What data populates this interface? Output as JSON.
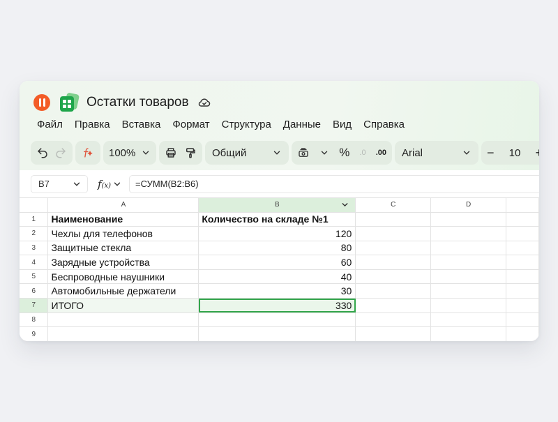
{
  "app": {
    "title": "Остатки товаров"
  },
  "menu": [
    "Файл",
    "Правка",
    "Вставка",
    "Формат",
    "Структура",
    "Данные",
    "Вид",
    "Справка"
  ],
  "toolbar": {
    "zoom": "100%",
    "number_format": "Общий",
    "percent": "%",
    "decrease_decimals": ".0",
    "increase_decimals": ".00",
    "font": "Arial",
    "font_size": "10",
    "minus": "−",
    "plus": "+"
  },
  "namebar": {
    "cell_ref": "B7",
    "fx_label": "f",
    "fx_sub": "(x)",
    "formula": "=СУММ(B2:B6)"
  },
  "grid": {
    "columns": [
      "A",
      "B",
      "C",
      "D"
    ],
    "rows": [
      {
        "n": "1",
        "a": "Наименование",
        "b": "Количество на складе №1"
      },
      {
        "n": "2",
        "a": "Чехлы для телефонов",
        "b": "120"
      },
      {
        "n": "3",
        "a": "Защитные стекла",
        "b": "80"
      },
      {
        "n": "4",
        "a": "Зарядные устройства",
        "b": "60"
      },
      {
        "n": "5",
        "a": "Беспроводные наушники",
        "b": "40"
      },
      {
        "n": "6",
        "a": "Автомобильные держатели",
        "b": "30"
      },
      {
        "n": "7",
        "a": "ИТОГО",
        "b": "330"
      },
      {
        "n": "8",
        "a": "",
        "b": ""
      },
      {
        "n": "9",
        "a": "",
        "b": ""
      }
    ]
  },
  "colors": {
    "accent": "#33a64b",
    "brand_orange": "#f35c27",
    "header_bg": "#eff6ee"
  }
}
